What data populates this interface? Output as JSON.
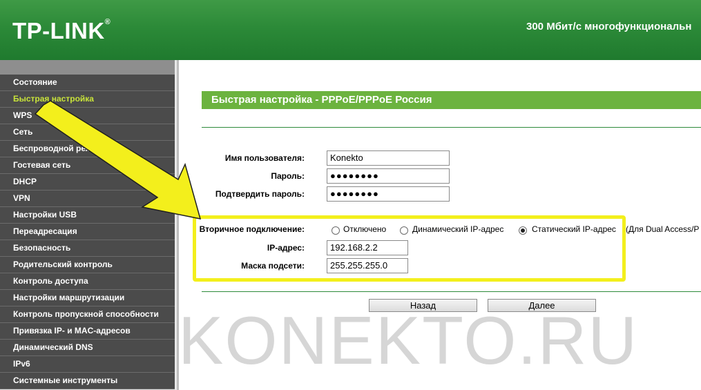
{
  "header": {
    "logo": "TP-LINK",
    "logo_mark": "®",
    "product": "300 Мбит/с многофункциональн"
  },
  "sidebar": {
    "items": [
      {
        "label": "Состояние"
      },
      {
        "label": "Быстрая настройка",
        "active": true
      },
      {
        "label": "WPS"
      },
      {
        "label": "Сеть"
      },
      {
        "label": "Беспроводной режим"
      },
      {
        "label": "Гостевая сеть"
      },
      {
        "label": "DHCP"
      },
      {
        "label": "VPN"
      },
      {
        "label": "Настройки USB"
      },
      {
        "label": "Переадресация"
      },
      {
        "label": "Безопасность"
      },
      {
        "label": "Родительский контроль"
      },
      {
        "label": "Контроль доступа"
      },
      {
        "label": "Настройки маршрутизации"
      },
      {
        "label": "Контроль пропускной способности"
      },
      {
        "label": "Привязка IP- и MAC-адресов"
      },
      {
        "label": "Динамический DNS"
      },
      {
        "label": "IPv6"
      },
      {
        "label": "Системные инструменты"
      }
    ]
  },
  "main": {
    "section_title": "Быстрая настройка - PPPoE/PPPoE Россия",
    "username": {
      "label": "Имя пользователя:",
      "value": "Konekto"
    },
    "password": {
      "label": "Пароль:",
      "value": "●●●●●●●●"
    },
    "confirm_password": {
      "label": "Подтвердить пароль:",
      "value": "●●●●●●●●"
    },
    "secondary": {
      "label": "Вторичное подключение:",
      "options": [
        {
          "label": "Отключено",
          "checked": false
        },
        {
          "label": "Динамический IP-адрес",
          "checked": false
        },
        {
          "label": "Статический IP-адрес",
          "checked": true
        }
      ],
      "note": "(Для Dual Access/P"
    },
    "ip_address": {
      "label": "IP-адрес:",
      "value": "192.168.2.2"
    },
    "subnet_mask": {
      "label": "Маска подсети:",
      "value": "255.255.255.0"
    },
    "buttons": {
      "back": "Назад",
      "next": "Далее"
    }
  },
  "annotations": {
    "highlight_color": "#f3ef1c",
    "watermark": "KONEKTO.RU"
  }
}
